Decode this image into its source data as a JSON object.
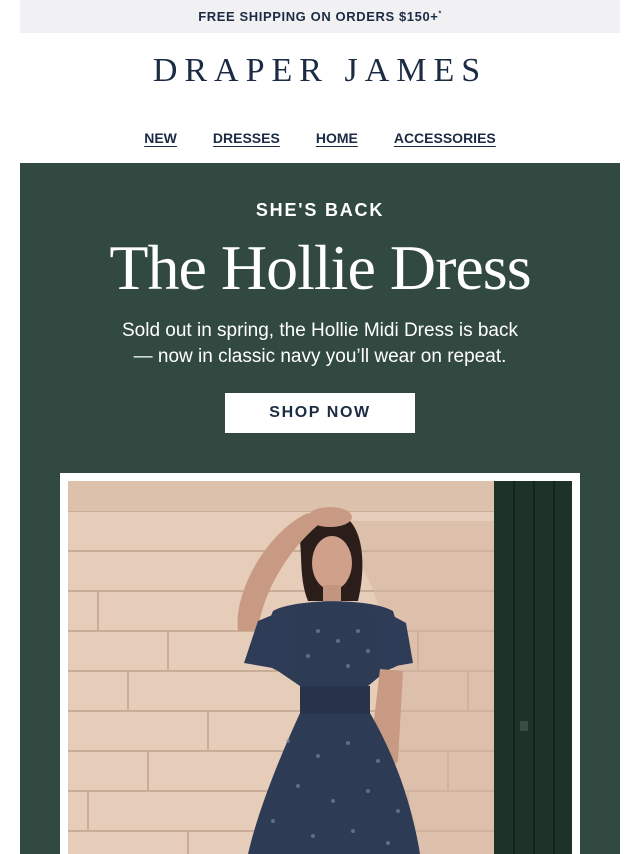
{
  "promo": {
    "text": "FREE SHIPPING ON ORDERS $150+",
    "footnote_mark": "*"
  },
  "brand": {
    "logo_text": "DRAPER JAMES"
  },
  "nav": {
    "items": [
      {
        "label": "NEW"
      },
      {
        "label": "DRESSES"
      },
      {
        "label": "HOME"
      },
      {
        "label": "ACCESSORIES"
      }
    ]
  },
  "hero": {
    "eyebrow": "SHE'S BACK",
    "headline": "The Hollie Dress",
    "subcopy_line1": "Sold out in spring, the Hollie Midi Dress is back",
    "subcopy_line2": "— now in classic navy you’ll wear on repeat.",
    "cta_label": "SHOP NOW",
    "background_color": "#324941",
    "image_subject": "model in navy printed midi dress against cream brick wall"
  },
  "colors": {
    "navy": "#1c2b44",
    "hero_green": "#324941",
    "promo_bg": "#f1f1f3"
  }
}
